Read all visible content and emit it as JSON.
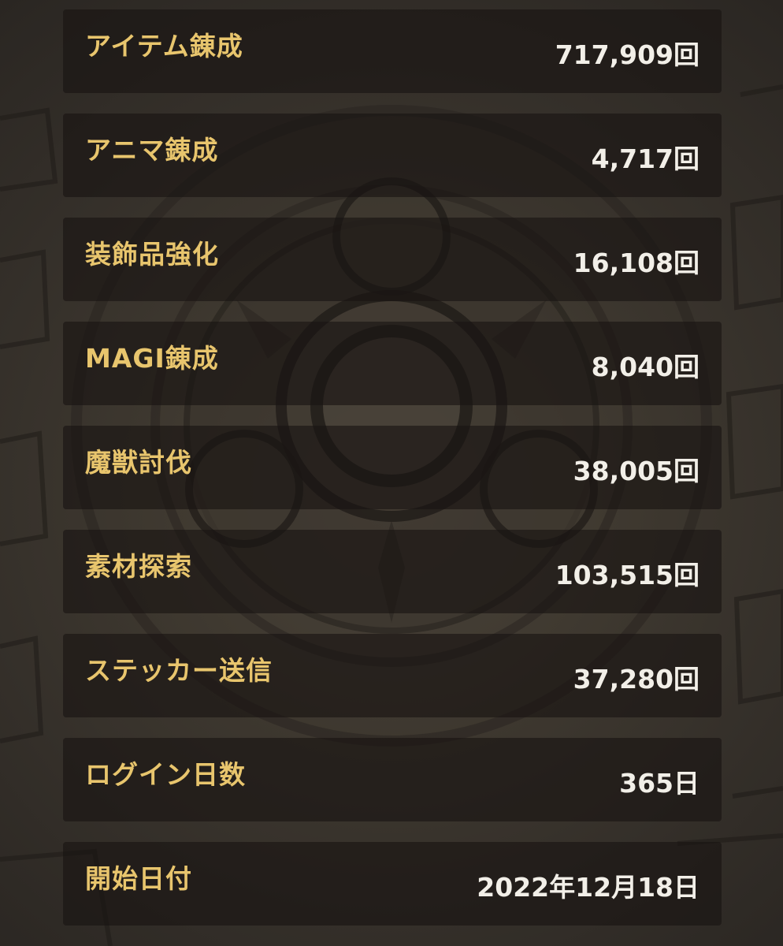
{
  "stats": [
    {
      "label": "アイテム錬成",
      "value": "717,909回"
    },
    {
      "label": "アニマ錬成",
      "value": "4,717回"
    },
    {
      "label": "装飾品強化",
      "value": "16,108回"
    },
    {
      "label": "MAGI錬成",
      "value": "8,040回"
    },
    {
      "label": "魔獣討伐",
      "value": "38,005回"
    },
    {
      "label": "素材探索",
      "value": "103,515回"
    },
    {
      "label": "ステッカー送信",
      "value": "37,280回"
    },
    {
      "label": "ログイン日数",
      "value": "365日"
    },
    {
      "label": "開始日付",
      "value": "2022年12月18日"
    }
  ],
  "colors": {
    "label": "#e8c56d",
    "value": "#f2efe8",
    "background": "#3f3930"
  }
}
